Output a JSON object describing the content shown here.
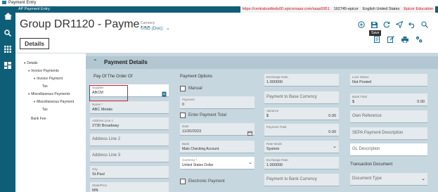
{
  "window": {
    "title": "Payment Entry"
  },
  "app": {
    "name": "AP Payment Entry",
    "url": "https://centralusdtedu00.epicorsaas.com/saas5951",
    "build": "162745-epicor",
    "language": "English United States",
    "company": "Epicor Education"
  },
  "header": {
    "title": "Group DR1120 - Payme…",
    "currency_label": "Currency",
    "currency_value": "USD (Doc)",
    "save_tooltip": "Save"
  },
  "tabs": {
    "details": "Details"
  },
  "tree": {
    "items": [
      {
        "label": "Details",
        "level": 0,
        "caret": "▾"
      },
      {
        "label": "Invoice Payments",
        "level": 1,
        "caret": "▾"
      },
      {
        "label": "Invoice Payment",
        "level": 2,
        "caret": "▾"
      },
      {
        "label": "Tax",
        "level": 3,
        "caret": ""
      },
      {
        "label": "Miscellaneous Payments",
        "level": 1,
        "caret": "▾"
      },
      {
        "label": "Miscellaneous Payment",
        "level": 2,
        "caret": "▾"
      },
      {
        "label": "Tax",
        "level": 3,
        "caret": ""
      },
      {
        "label": "Bank Fee",
        "level": 1,
        "caret": ""
      }
    ]
  },
  "panel": {
    "title": "Payment Details",
    "col1": {
      "heading": "Pay Of The Order Of",
      "supplier_label": "Supplier",
      "supplier_value": "ABCM",
      "name_label": "Name *",
      "name_value": "ABC Metals",
      "addr1_label": "Address Line 1",
      "addr1_value": "2730 Broadway",
      "addr2_ph": "Address Line 2",
      "addr3_ph": "Address Line 3",
      "city_label": "City",
      "city_value": "St.Paul",
      "state_label": "State/Prov",
      "state_value": "MN"
    },
    "col2": {
      "heading": "Payment Options",
      "manual_label": "Manual",
      "payment_label": "Payment",
      "payment_value": "0",
      "enter_total_label": "Enter Payment Total",
      "date_label": "Date",
      "date_value": "11/20/2023",
      "bank_label": "Bank",
      "bank_value": "Main Checking Account",
      "currency_label": "Currency *",
      "currency_value": "United States Dollar",
      "electronic_label": "Electronic Payment"
    },
    "col3": {
      "exrate_label": "Exchange Rate",
      "exrate_value": "1.000000",
      "pay_to_base_ph": "Payment to Base Currency",
      "variance_label": "Variance",
      "variance_cur": "$",
      "variance_value": "0.00",
      "pay_total_label": "Payment Total",
      "pay_total_value": "0.00",
      "rate_mode_label": "Rate Mode",
      "rate_mode_value": "System",
      "exrate2_label": "Exchange Rate",
      "exrate2_value": "1.000000",
      "pay_to_bank_ph": "Payment to Bank Currency"
    },
    "col4": {
      "lock_label": "Lock Status",
      "lock_value": "Not Posted",
      "bank_total_label": "Bank Total",
      "bank_total_cur": "$",
      "bank_total_value": "0.00",
      "own_ref_ph": "Own Reference",
      "sepa_ph": "SEPA Payment Description",
      "gl_ph": "GL Description",
      "trans_doc_heading": "Transaction Document",
      "doc_type_ph": "Document Type"
    }
  }
}
